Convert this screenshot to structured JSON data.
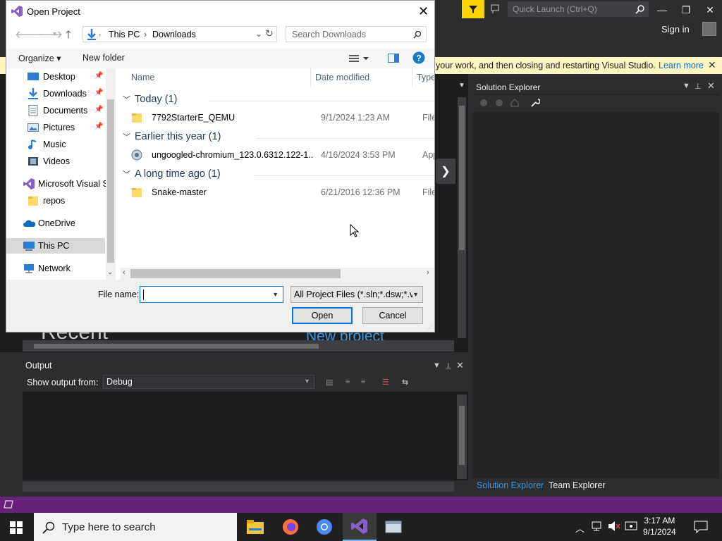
{
  "vs": {
    "quick_launch_placeholder": "Quick Launch (Ctrl+Q)",
    "sign_in": "Sign in",
    "window_controls": [
      "—",
      "❐",
      "✕"
    ],
    "infobar": {
      "message": "your work, and then closing and restarting Visual Studio.",
      "learn_more": "Learn more",
      "close": "✕"
    },
    "start_page": {
      "recent_heading": "Recent",
      "new_project": "New project"
    },
    "solution_explorer": {
      "title": "Solution Explorer",
      "tabs": [
        "Solution Explorer",
        "Team Explorer"
      ]
    },
    "output": {
      "title": "Output",
      "show_output_from": "Show output from:",
      "source": "Debug"
    },
    "accent": "#68217a"
  },
  "dialog": {
    "title": "Open Project",
    "close": "✕",
    "breadcrumb": [
      "This PC",
      "Downloads"
    ],
    "search_placeholder": "Search Downloads",
    "toolbar": {
      "organize": "Organize ▾",
      "new_folder": "New folder"
    },
    "nav": [
      {
        "label": "Desktop",
        "icon": "desktop-icon",
        "pinned": true
      },
      {
        "label": "Downloads",
        "icon": "download-icon",
        "pinned": true
      },
      {
        "label": "Documents",
        "icon": "document-icon",
        "pinned": true
      },
      {
        "label": "Pictures",
        "icon": "pictures-icon",
        "pinned": true
      },
      {
        "label": "Music",
        "icon": "music-icon",
        "pinned": false
      },
      {
        "label": "Videos",
        "icon": "videos-icon",
        "pinned": false
      },
      {
        "label": "Microsoft Visual S",
        "icon": "visual-studio-icon",
        "pinned": false
      },
      {
        "label": "repos",
        "icon": "folder-icon",
        "pinned": false
      },
      {
        "label": "OneDrive",
        "icon": "onedrive-icon",
        "pinned": false
      },
      {
        "label": "This PC",
        "icon": "this-pc-icon",
        "pinned": false
      },
      {
        "label": "Network",
        "icon": "network-icon",
        "pinned": false
      }
    ],
    "columns": {
      "name": "Name",
      "date": "Date modified",
      "type": "Type"
    },
    "groups": [
      {
        "label": "Today (1)",
        "files": [
          {
            "name": "7792StarterE_QEMU",
            "date": "9/1/2024 1:23 AM",
            "type": "File fo",
            "icon": "folder-icon"
          }
        ]
      },
      {
        "label": "Earlier this year (1)",
        "files": [
          {
            "name": "ungoogled-chromium_123.0.6312.122-1...",
            "date": "4/16/2024 3:53 PM",
            "type": "Appli",
            "icon": "installer-icon"
          }
        ]
      },
      {
        "label": "A long time ago (1)",
        "files": [
          {
            "name": "Snake-master",
            "date": "6/21/2016 12:36 PM",
            "type": "File fo",
            "icon": "folder-icon"
          }
        ]
      }
    ],
    "file_name_label": "File name:",
    "file_name_value": "",
    "file_type": "All Project Files (*.sln;*.dsw;*.vc",
    "open": "Open",
    "cancel": "Cancel"
  },
  "taskbar": {
    "search_placeholder": "Type here to search",
    "time": "3:17 AM",
    "date": "9/1/2024"
  }
}
